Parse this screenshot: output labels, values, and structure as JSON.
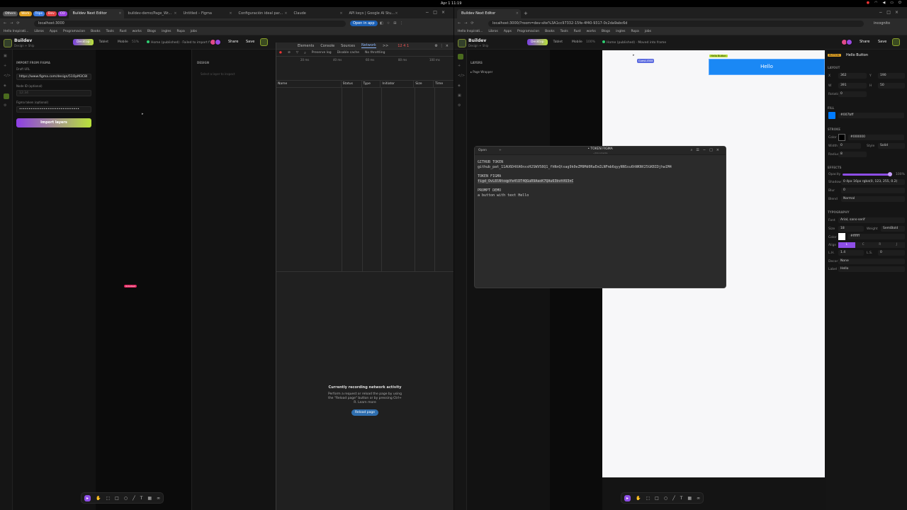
{
  "system": {
    "clock": "Apr 1 11:19"
  },
  "left_window": {
    "tab_pills": [
      "Others",
      "Work",
      "Trips",
      "Dev",
      "CO"
    ],
    "tabs": [
      "Buildev Next Editor",
      "buildev-demo/Page_Wr...",
      "Untitled – Figma",
      "Configuración ideal par...",
      "Claude",
      "API keys | Google AI Stu..."
    ],
    "address": "localhost:3000",
    "open_in_app": "Open in app",
    "bookmarks": [
      "Hello Inspirati...",
      "Libros",
      "Apps",
      "Programacion",
      "Books",
      "Tools",
      "Rust",
      "works",
      "Blogs",
      "ingles",
      "Ropa",
      "jobs"
    ],
    "editor": {
      "brand": "Buildev",
      "brand_sub": "Design + Ship",
      "device_tabs": [
        "Desktop",
        "Tablet",
        "Mobile"
      ],
      "zoom": "51%",
      "status": "Home (published) · Failed to import fi...",
      "share": "Share",
      "save": "Save",
      "import_title": "IMPORT FROM FIGMA",
      "draft_url_label": "Draft URL",
      "draft_url_value": "https://www.figma.com/design/51OpM3C8l",
      "node_id_label": "Node ID (optional)",
      "node_id_placeholder": "12:34",
      "token_label": "Figma token (optional)",
      "token_value": "••••••••••••••••••••••••••••••••",
      "import_button": "Import layers",
      "design_heading": "DESIGN",
      "design_empty": "Select a layer to inspect",
      "cursor_tag": "Unlocked"
    },
    "devtools": {
      "tabs": [
        "Elements",
        "Console",
        "Sources",
        "Network",
        ">>"
      ],
      "badges": "12  4  1",
      "filters": [
        "Preserve log",
        "Disable cache",
        "No throttling"
      ],
      "timeline_ticks": [
        "20 ms",
        "40 ms",
        "60 ms",
        "80 ms",
        "100 ms"
      ],
      "columns": [
        "Name",
        "Status",
        "Type",
        "Initiator",
        "Size",
        "Time"
      ],
      "recording_title": "Currently recording network activity",
      "recording_desc1": "Perform a request or reload the page by using",
      "recording_desc2": "the \"Reload page\" button or by pressing Ctrl+",
      "recording_desc3": "R. Learn more",
      "reload_button": "Reload page"
    }
  },
  "right_window": {
    "tabs": [
      "Buildev Next Editor"
    ],
    "address": "localhost:3000/?room=dev-site%3A1cc97332-15fe-4f40-9317-0c2da9abc6d",
    "profile": "incognito",
    "bookmarks": [
      "Hello Inspirati...",
      "Libros",
      "Apps",
      "Programacion",
      "Books",
      "Tools",
      "Rust",
      "works",
      "Blogs",
      "ingles",
      "Ropa",
      "jobs"
    ],
    "editor": {
      "brand": "Buildev",
      "brand_sub": "Design + Ship",
      "device_tabs": [
        "Desktop",
        "Tablet",
        "Mobile"
      ],
      "zoom": "100%",
      "status": "Home (published) · Moved into frame",
      "share": "Share",
      "save": "Save",
      "layers_title": "LAYERS",
      "layer_item": "Page Wrapper",
      "guest_tag": "Guest-4508",
      "canvas_tag": "Hello Button",
      "canvas_button": "Hello",
      "inspector": {
        "type_badge": "BUTTON",
        "name": "Hello Button",
        "layout": "LAYOUT",
        "x_label": "X",
        "x": "362",
        "y_label": "Y",
        "y": "190",
        "w_label": "W",
        "w": "391",
        "h_label": "H",
        "h": "50",
        "rotation_label": "Rotation",
        "rotation": "0",
        "fill": "FILL",
        "fill_value": "#007bff",
        "fill_color": "#007bff",
        "stroke": "STROKE",
        "stroke_color_label": "Color",
        "stroke_color": "#000000",
        "width_label": "Width",
        "width": "0",
        "style_label": "Style",
        "style": "Solid",
        "radius_label": "Radius",
        "radius": "8",
        "effects": "EFFECTS",
        "opacity_label": "Opacity",
        "opacity": "100%",
        "shadow_label": "Shadow",
        "shadow": "0 4px 16px rgba(0, 123, 255, 0.2)",
        "blur_label": "Blur",
        "blur": "0",
        "blend_label": "Blend",
        "blend": "Normal",
        "typography": "TYPOGRAPHY",
        "font_label": "Font",
        "font": "Arial, sans-serif",
        "size_label": "Size",
        "size": "18",
        "weight_label": "Weight",
        "weight": "SemiBold",
        "color_label": "Color",
        "color": "#ffffff",
        "align_label": "Align",
        "aligns": [
          "L",
          "C",
          "R",
          "J"
        ],
        "lh_label": "L.H.",
        "lh": "1.4",
        "ls_label": "L.S.",
        "ls": "0",
        "decor_label": "Decor",
        "decor": "None",
        "label_label": "Label",
        "label": "Hello"
      }
    }
  },
  "terminal": {
    "open_label": "Open",
    "title": "• TOKEN FIGMA",
    "subtitle": "~/Documents",
    "lines": [
      "GITHUB TOKEN",
      "github_pat_11AU6D4XA0nxsH2SWV58Q1_fhNnQtxag9k0eZM9Md0RaEmILNFmb6qyyNNSsu6hNKNV25GKBIDjhw1M4",
      "",
      "TOKEN FIGMA",
      "figd_OvL8lNtoqpYe4lDT4QGuR9AaoK7QAu63bvhVU3nC",
      "",
      "PROMPT DEMO",
      "a button with text Hello"
    ]
  }
}
